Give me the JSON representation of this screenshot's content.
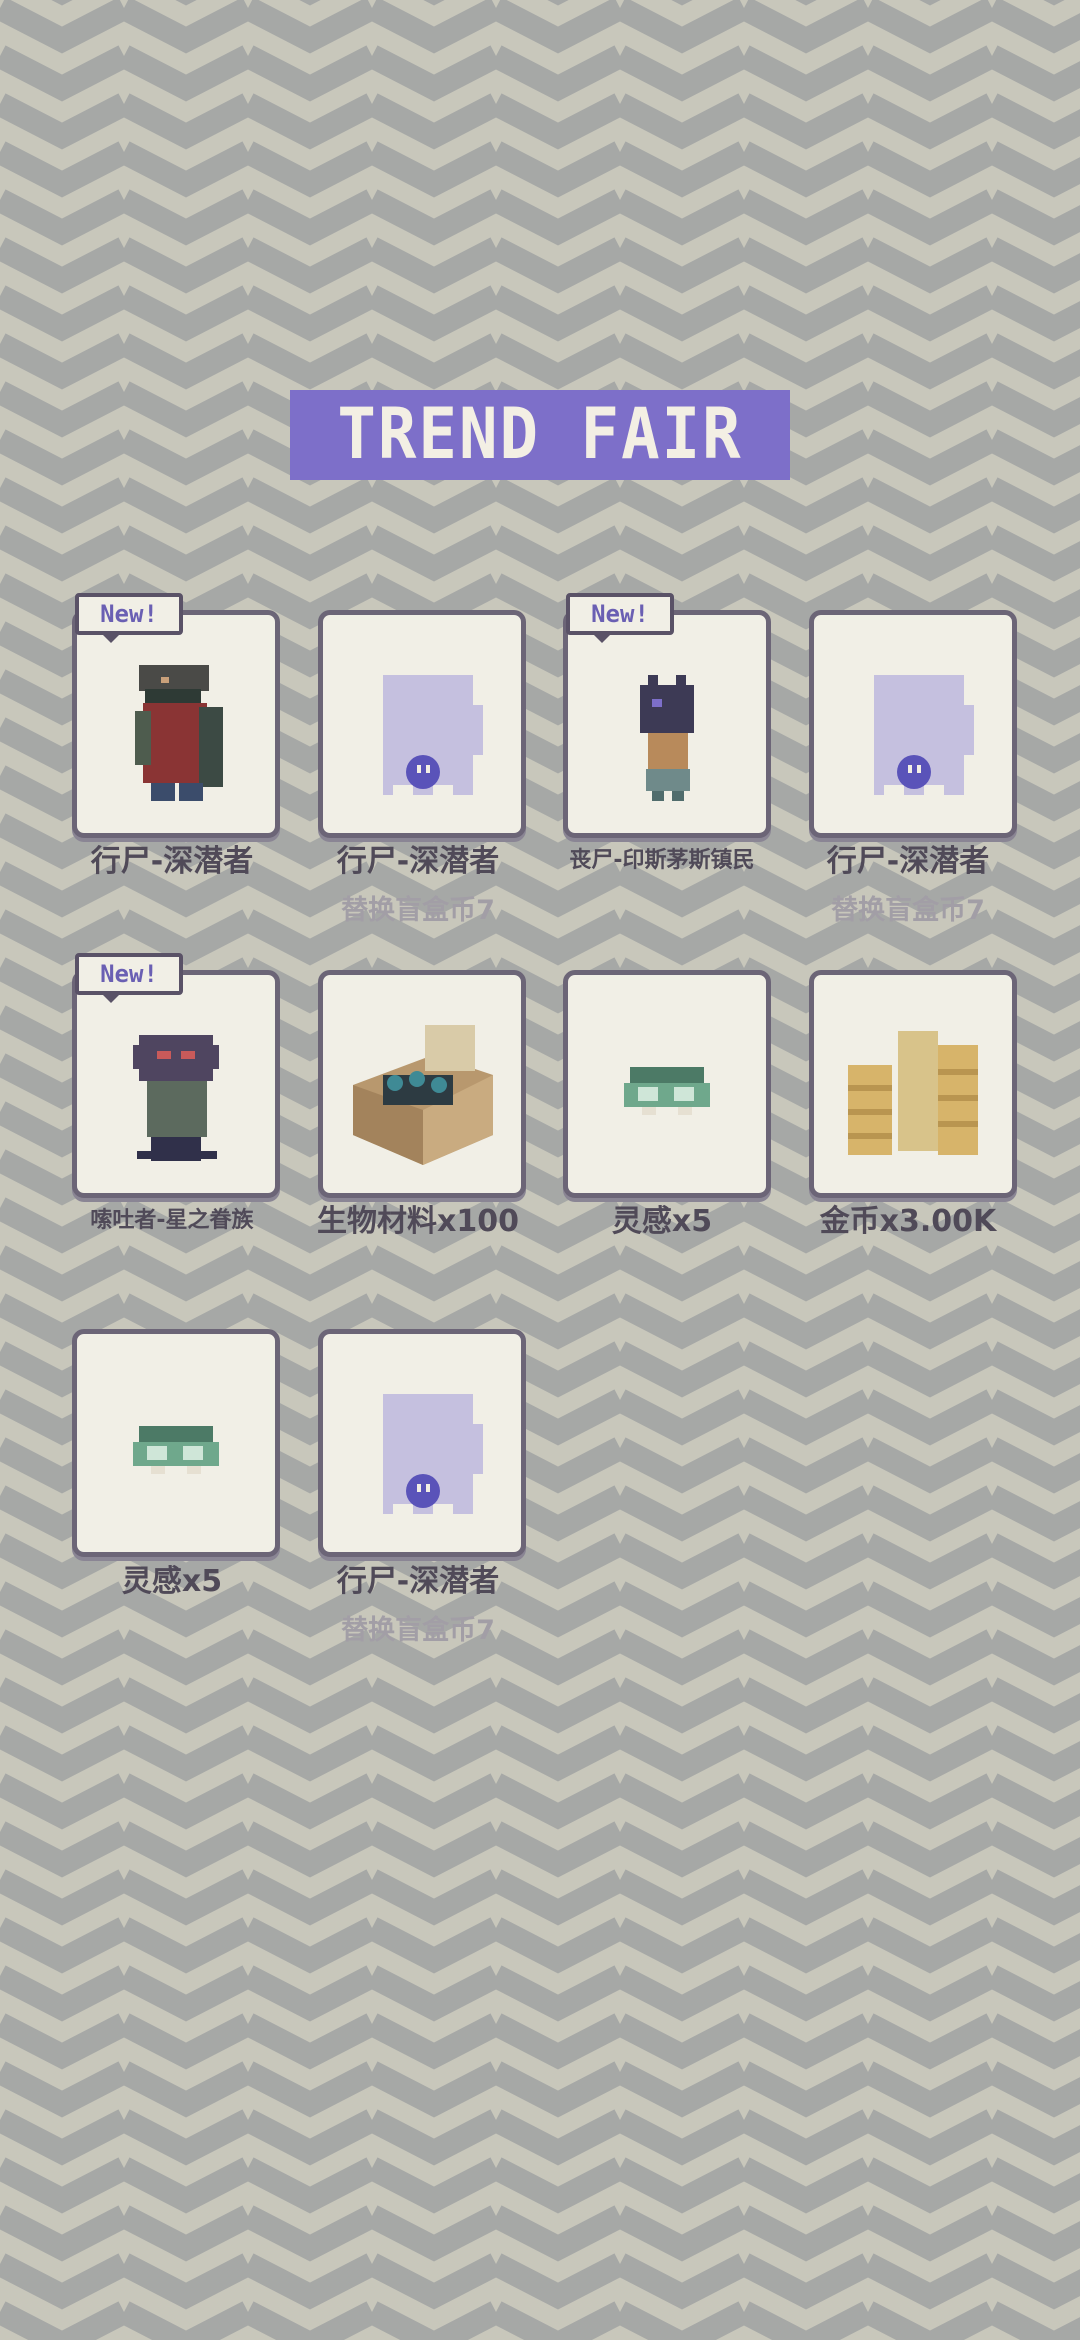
{
  "title": "TREND FAIR",
  "badge_text": "New!",
  "items": [
    {
      "label": "行尸-深潜者",
      "sub": "",
      "new": true,
      "icon": "zombie-diver-icon"
    },
    {
      "label": "行尸-深潜者",
      "sub": "替换盲盒币7",
      "new": false,
      "icon": "ghost-icon"
    },
    {
      "label": "丧尸-印斯茅斯镇民",
      "sub": "",
      "new": true,
      "icon": "zombie-innsmouth-icon"
    },
    {
      "label": "行尸-深潜者",
      "sub": "替换盲盒币7",
      "new": false,
      "icon": "ghost-icon"
    },
    {
      "label": "嗦吐者-星之眷族",
      "sub": "",
      "new": true,
      "icon": "star-spawn-icon"
    },
    {
      "label": "生物材料x100",
      "sub": "",
      "new": false,
      "icon": "material-box-icon"
    },
    {
      "label": "灵感x5",
      "sub": "",
      "new": false,
      "icon": "brain-icon"
    },
    {
      "label": "金币x3.00K",
      "sub": "",
      "new": false,
      "icon": "gold-coins-icon"
    },
    {
      "label": "灵感x5",
      "sub": "",
      "new": false,
      "icon": "brain-icon"
    },
    {
      "label": "行尸-深潜者",
      "sub": "替换盲盒币7",
      "new": false,
      "icon": "ghost-icon"
    }
  ]
}
